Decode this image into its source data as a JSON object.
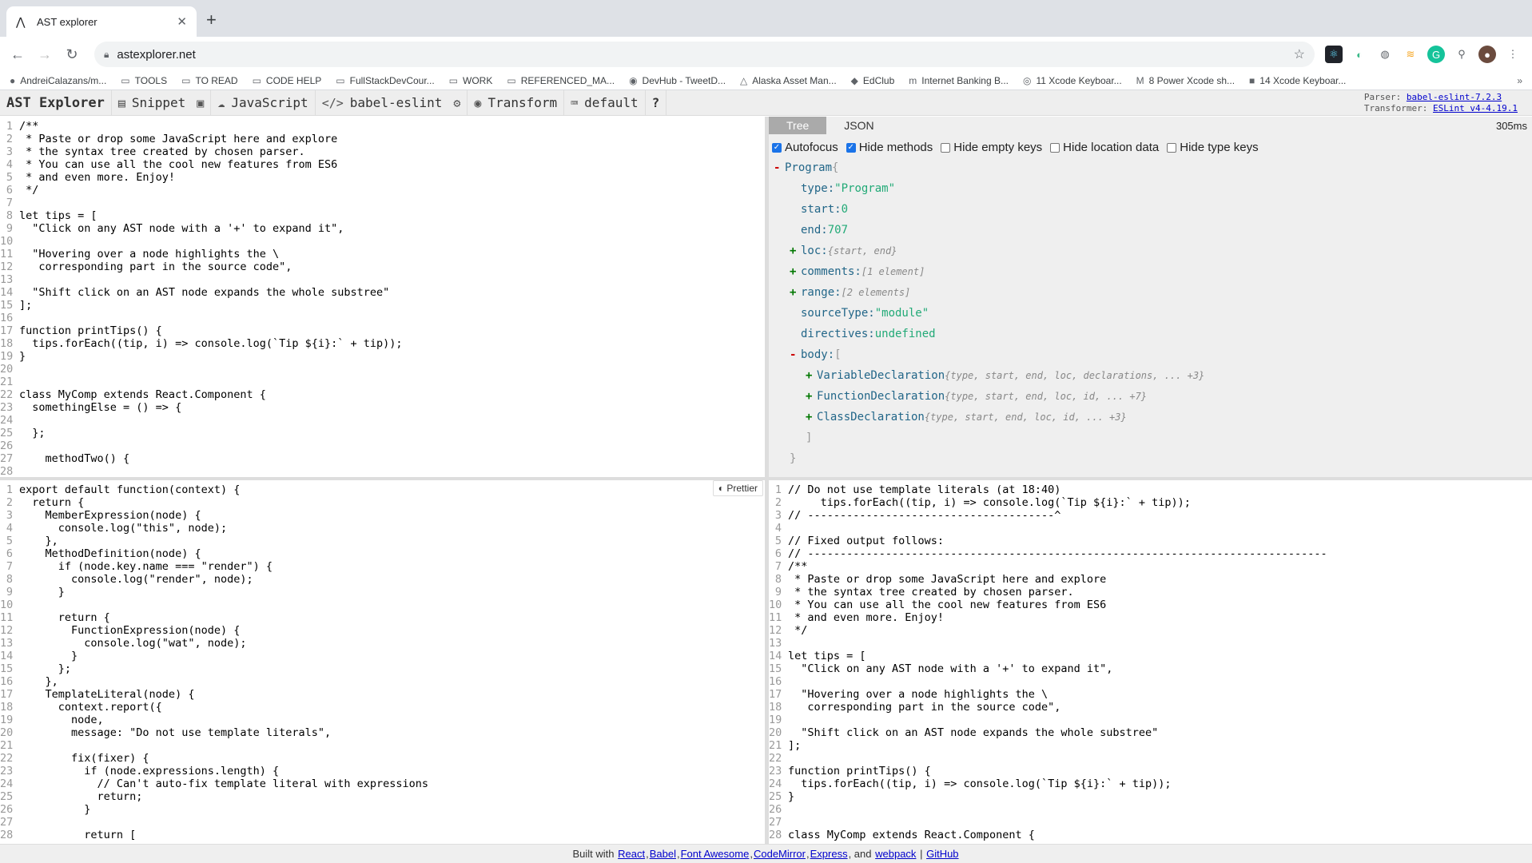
{
  "browser": {
    "tab_title": "AST explorer",
    "url": "astexplorer.net",
    "bookmarks": [
      {
        "icon": "github-icon",
        "glyph": "●",
        "label": "AndreiCalazans/m..."
      },
      {
        "icon": "folder-icon",
        "glyph": "▭",
        "label": "TOOLS"
      },
      {
        "icon": "folder-icon",
        "glyph": "▭",
        "label": "TO READ"
      },
      {
        "icon": "folder-icon",
        "glyph": "▭",
        "label": "CODE HELP"
      },
      {
        "icon": "folder-icon",
        "glyph": "▭",
        "label": "FullStackDevCour..."
      },
      {
        "icon": "folder-icon",
        "glyph": "▭",
        "label": "WORK"
      },
      {
        "icon": "folder-icon",
        "glyph": "▭",
        "label": "REFERENCED_MA..."
      },
      {
        "icon": "devhub-icon",
        "glyph": "◉",
        "label": "DevHub - TweetD..."
      },
      {
        "icon": "alaska-icon",
        "glyph": "△",
        "label": "Alaska Asset Man..."
      },
      {
        "icon": "edclub-icon",
        "glyph": "◆",
        "label": "EdClub"
      },
      {
        "icon": "bank-icon",
        "glyph": "m",
        "label": "Internet Banking B..."
      },
      {
        "icon": "globe-icon",
        "glyph": "◎",
        "label": "11 Xcode Keyboar..."
      },
      {
        "icon": "medium-icon",
        "glyph": "M",
        "label": "8 Power Xcode sh..."
      },
      {
        "icon": "image-icon",
        "glyph": "■",
        "label": "14 Xcode Keyboar..."
      }
    ],
    "more": "»"
  },
  "toolbar": {
    "brand": "AST Explorer",
    "snippet": "Snippet",
    "language": "JavaScript",
    "parser": "babel-eslint",
    "transform": "Transform",
    "keymap": "default",
    "help": "?",
    "parser_label": "Parser:",
    "parser_link": "babel-eslint-7.2.3",
    "transformer_label": "Transformer:",
    "transformer_link": "ESLint v4-4.19.1"
  },
  "source_code": [
    "/**",
    " * Paste or drop some JavaScript here and explore",
    " * the syntax tree created by chosen parser.",
    " * You can use all the cool new features from ES6",
    " * and even more. Enjoy!",
    " */",
    "",
    "let tips = [",
    "  \"Click on any AST node with a '+' to expand it\",",
    "",
    "  \"Hovering over a node highlights the \\",
    "   corresponding part in the source code\",",
    "",
    "  \"Shift click on an AST node expands the whole substree\"",
    "];",
    "",
    "function printTips() {",
    "  tips.forEach((tip, i) => console.log(`Tip ${i}:` + tip));",
    "}",
    "",
    "",
    "class MyComp extends React.Component {",
    "  somethingElse = () => {",
    "",
    "  };",
    "",
    "    methodTwo() {",
    ""
  ],
  "ast_panel": {
    "tabs": [
      "Tree",
      "JSON"
    ],
    "active_tab": "Tree",
    "timing": "305ms",
    "options": [
      {
        "label": "Autofocus",
        "checked": true
      },
      {
        "label": "Hide methods",
        "checked": true
      },
      {
        "label": "Hide empty keys",
        "checked": false
      },
      {
        "label": "Hide location data",
        "checked": false
      },
      {
        "label": "Hide type keys",
        "checked": false
      }
    ],
    "tree": {
      "root": "Program",
      "root_brace": "{",
      "type_key": "type:",
      "type_val": "\"Program\"",
      "start_key": "start:",
      "start_val": "0",
      "end_key": "end:",
      "end_val": "707",
      "loc_key": "loc:",
      "loc_sum": "{start, end}",
      "comments_key": "comments:",
      "comments_sum": "[1 element]",
      "range_key": "range:",
      "range_sum": "[2 elements]",
      "sourceType_key": "sourceType:",
      "sourceType_val": "\"module\"",
      "directives_key": "directives:",
      "directives_val": "undefined",
      "body_key": "body:",
      "body_bracket": "[",
      "body_items": [
        {
          "name": "VariableDeclaration",
          "sum": "{type, start, end, loc, declarations, ... +3}"
        },
        {
          "name": "FunctionDeclaration",
          "sum": "{type, start, end, loc, id, ... +7}"
        },
        {
          "name": "ClassDeclaration",
          "sum": "{type, start, end, loc, id, ... +3}"
        }
      ],
      "close_bracket": "]",
      "close_brace": "}"
    }
  },
  "transform_code": {
    "prettier_label": "Prettier",
    "lines": [
      "export default function(context) {",
      "  return {",
      "    MemberExpression(node) {",
      "      console.log(\"this\", node);",
      "    },",
      "    MethodDefinition(node) {",
      "      if (node.key.name === \"render\") {",
      "        console.log(\"render\", node);",
      "      }",
      "",
      "      return {",
      "        FunctionExpression(node) {",
      "          console.log(\"wat\", node);",
      "        }",
      "      };",
      "    },",
      "    TemplateLiteral(node) {",
      "      context.report({",
      "        node,",
      "        message: \"Do not use template literals\",",
      "",
      "        fix(fixer) {",
      "          if (node.expressions.length) {",
      "            // Can't auto-fix template literal with expressions",
      "            return;",
      "          }",
      "",
      "          return ["
    ]
  },
  "output_code": [
    "// Do not use template literals (at 18:40)",
    "     tips.forEach((tip, i) => console.log(`Tip ${i}:` + tip));",
    "// --------------------------------------^",
    "",
    "// Fixed output follows:",
    "// --------------------------------------------------------------------------------",
    "/**",
    " * Paste or drop some JavaScript here and explore",
    " * the syntax tree created by chosen parser.",
    " * You can use all the cool new features from ES6",
    " * and even more. Enjoy!",
    " */",
    "",
    "let tips = [",
    "  \"Click on any AST node with a '+' to expand it\",",
    "",
    "  \"Hovering over a node highlights the \\",
    "   corresponding part in the source code\",",
    "",
    "  \"Shift click on an AST node expands the whole substree\"",
    "];",
    "",
    "function printTips() {",
    "  tips.forEach((tip, i) => console.log(`Tip ${i}:` + tip));",
    "}",
    "",
    "",
    "class MyComp extends React.Component {"
  ],
  "footer": {
    "prefix": "Built with",
    "links": [
      "React",
      "Babel",
      "Font Awesome",
      "CodeMirror",
      "Express"
    ],
    "and": ", and",
    "webpack": "webpack",
    "sep": "|",
    "github": "GitHub"
  }
}
